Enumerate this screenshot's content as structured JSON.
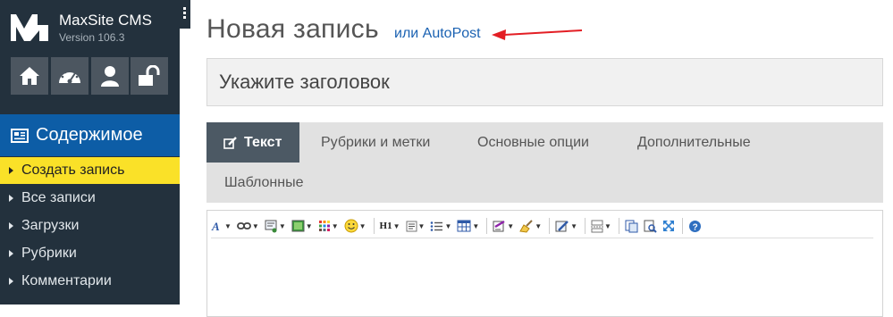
{
  "sidebar": {
    "brand": {
      "name": "MaxSite CMS",
      "version": "Version 106.3"
    },
    "icon_buttons": [
      {
        "icon": "home-icon"
      },
      {
        "icon": "dashboard-icon"
      },
      {
        "icon": "user-icon"
      },
      {
        "icon": "unlock-icon"
      }
    ],
    "section": {
      "label": "Содержимое",
      "icon": "newspaper-icon"
    },
    "menu": [
      {
        "label": "Создать запись",
        "active": true
      },
      {
        "label": "Все записи"
      },
      {
        "label": "Загрузки"
      },
      {
        "label": "Рубрики"
      },
      {
        "label": "Комментарии"
      }
    ]
  },
  "main": {
    "title": "Новая запись",
    "autopost_link": "или AutoPost",
    "title_placeholder": "Укажите заголовок",
    "tabs": [
      {
        "label": "Текст",
        "active": true,
        "icon": "edit-icon"
      },
      {
        "label": "Рубрики и метки"
      },
      {
        "label": "Основные опции"
      },
      {
        "label": "Дополнительные"
      },
      {
        "label": "Шаблонные"
      }
    ],
    "toolbar": {
      "heading_label": "H1",
      "buttons": [
        "font-icon",
        "link-icon",
        "insert-icon",
        "image-icon",
        "color-grid-icon",
        "smiley-icon",
        "heading-icon",
        "align-icon",
        "list-icon",
        "table-icon",
        "markup-icon",
        "clean-icon",
        "code-icon",
        "page-break-icon",
        "copy-icon",
        "preview-icon",
        "fullscreen-icon",
        "help-icon"
      ]
    }
  },
  "colors": {
    "sidebar_bg": "#23313d",
    "section_bg": "#0d5da6",
    "active_item_bg": "#fae128",
    "link": "#1b62b2",
    "arrow": "#e31e24",
    "active_tab_bg": "#4c5964",
    "tabs_bg": "#e1e1e1"
  }
}
